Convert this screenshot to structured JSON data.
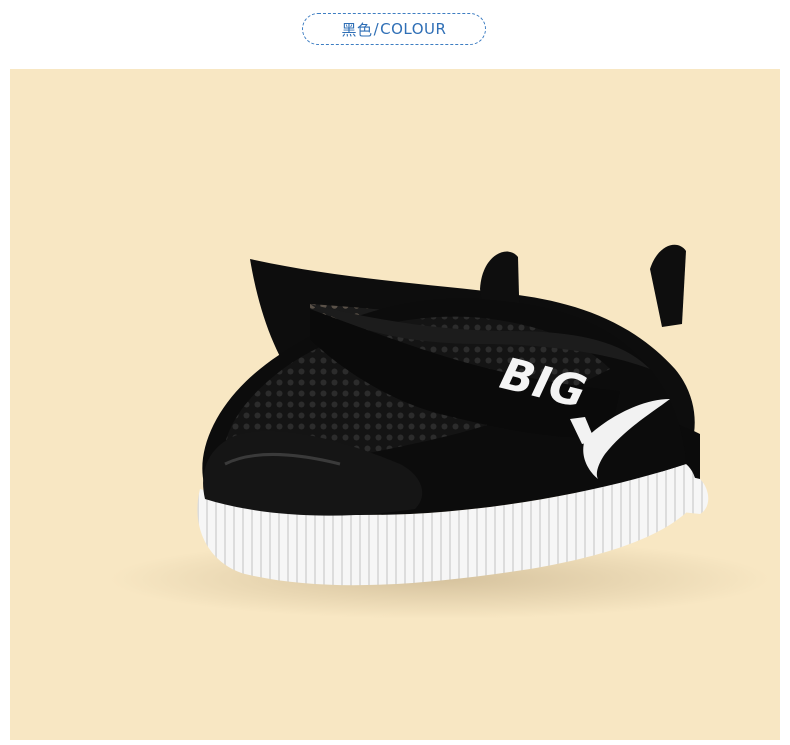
{
  "colour_label": {
    "chinese": "黑色",
    "separator": "/",
    "english": "COLOUR"
  },
  "product_image": {
    "subject": "black-mesh-slip-on-sneakers",
    "background_color": "#f8e7c3",
    "shoe_upper_color": "#111111",
    "sole_color": "#f5f5f5",
    "accent_color": "#ffffff"
  },
  "tongue_logo": {
    "text": "BIG"
  }
}
